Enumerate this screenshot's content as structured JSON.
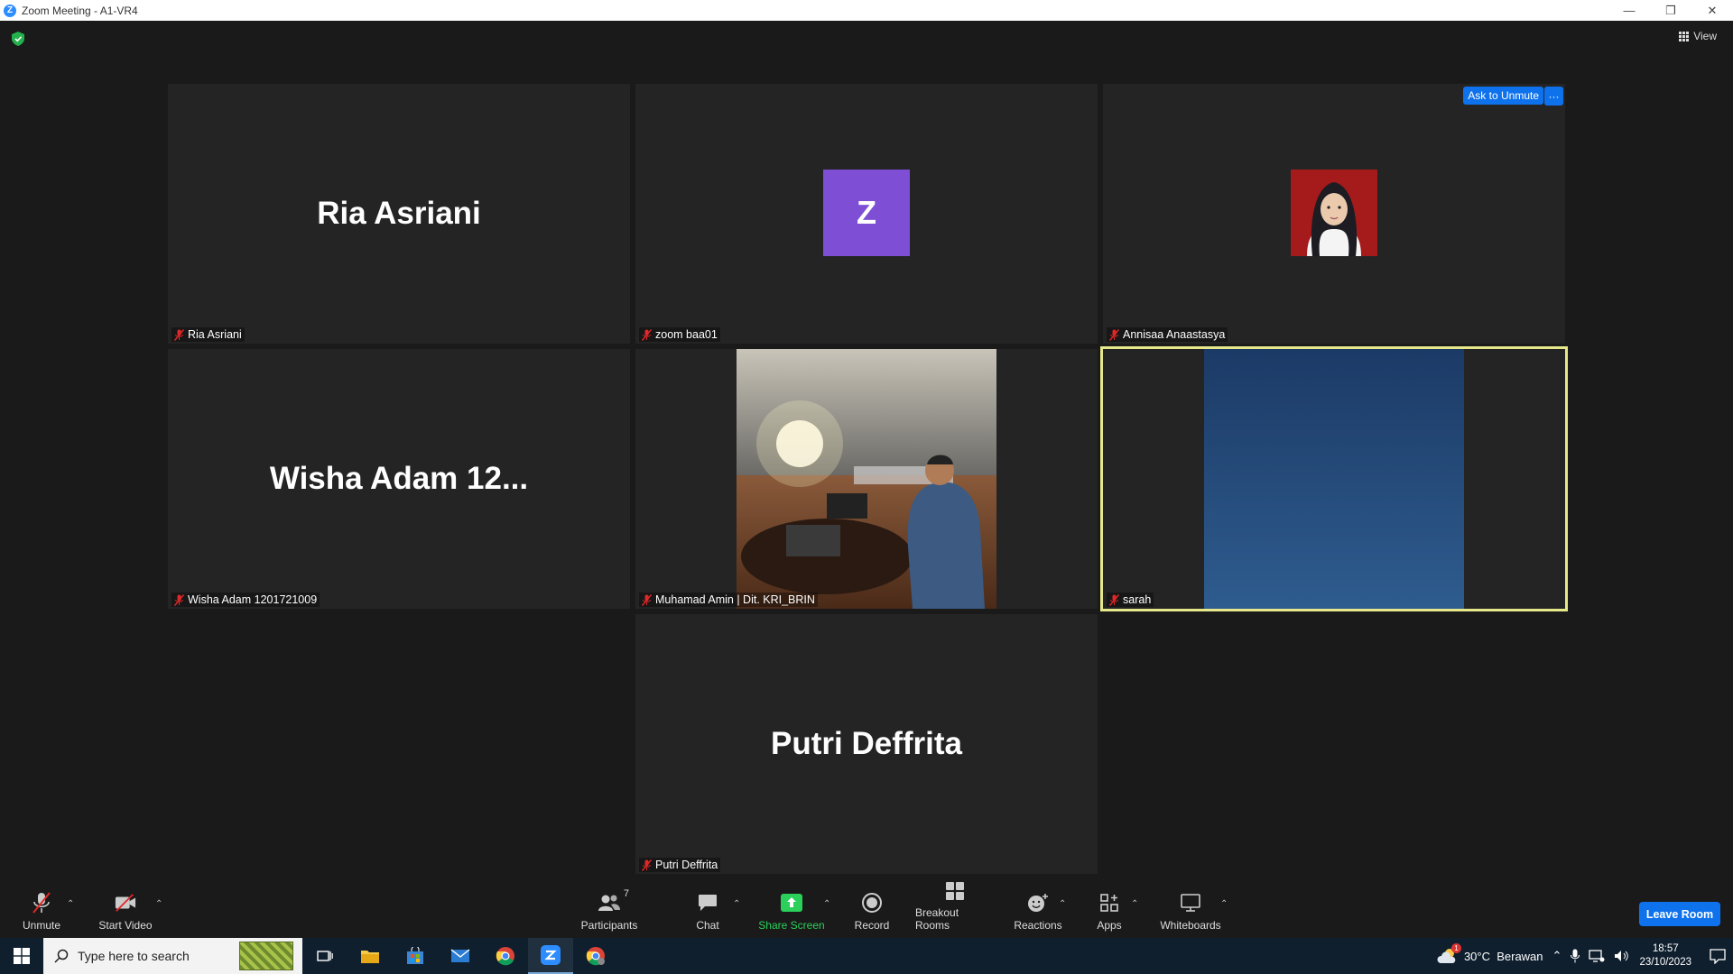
{
  "window": {
    "title": "Zoom Meeting - A1-VR4",
    "view_label": "View"
  },
  "tiles": [
    {
      "display": "Ria Asriani",
      "label": "Ria Asriani"
    },
    {
      "avatar_letter": "Z",
      "label": "zoom baa01"
    },
    {
      "label": "Annisaa Anaastasya",
      "ask_unmute": "Ask to Unmute",
      "more": "···"
    },
    {
      "display": "Wisha Adam 12...",
      "label": "Wisha Adam 1201721009"
    },
    {
      "label": "Muhamad Amin | Dit. KRI_BRIN"
    },
    {
      "label": "sarah"
    },
    {
      "display": "Putri Deffrita",
      "label": "Putri Deffrita"
    }
  ],
  "toolbar": {
    "unmute": "Unmute",
    "start_video": "Start Video",
    "participants": "Participants",
    "participants_count": "7",
    "chat": "Chat",
    "share_screen": "Share Screen",
    "record": "Record",
    "breakout_rooms": "Breakout Rooms",
    "reactions": "Reactions",
    "apps": "Apps",
    "whiteboards": "Whiteboards",
    "leave_room": "Leave Room"
  },
  "taskbar": {
    "search_placeholder": "Type here to search",
    "weather": "30°C  Berawan",
    "weather_badge": "1",
    "time": "18:57",
    "date": "23/10/2023"
  },
  "colors": {
    "accent": "#0e72ed",
    "active_speaker": "#e6e88a",
    "share_green": "#2ad05a",
    "mute_red": "#e02828",
    "avatar_purple": "#7e4fd4"
  }
}
